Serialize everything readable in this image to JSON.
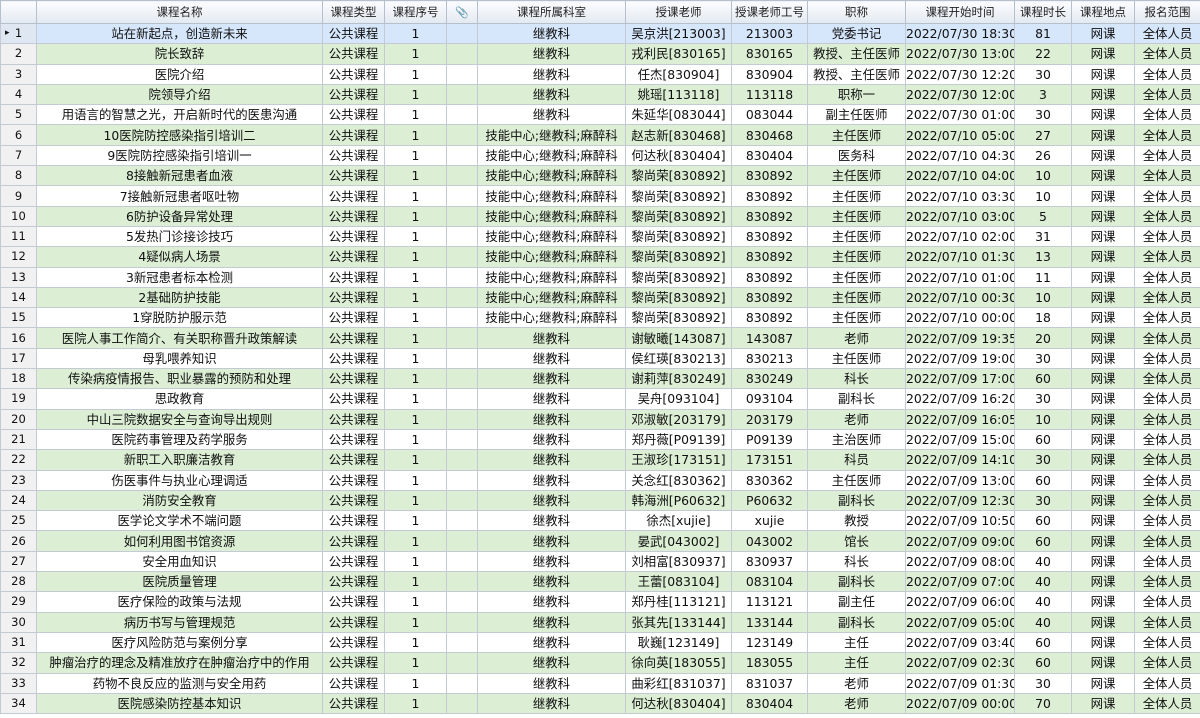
{
  "columns": [
    {
      "key": "rn",
      "label": ""
    },
    {
      "key": "name",
      "label": "课程名称"
    },
    {
      "key": "type",
      "label": "课程类型"
    },
    {
      "key": "seq",
      "label": "课程序号"
    },
    {
      "key": "attach",
      "label": "",
      "icon": "paperclip-icon"
    },
    {
      "key": "dept",
      "label": "课程所属科室"
    },
    {
      "key": "teacher",
      "label": "授课老师"
    },
    {
      "key": "tid",
      "label": "授课老师工号"
    },
    {
      "key": "title",
      "label": "职称"
    },
    {
      "key": "start",
      "label": "课程开始时间"
    },
    {
      "key": "duration",
      "label": "课程时长"
    },
    {
      "key": "place",
      "label": "课程地点"
    },
    {
      "key": "scope",
      "label": "报名范围"
    }
  ],
  "selected_row": 1,
  "rows": [
    {
      "rn": "1",
      "name": "站在新起点，创造新未来",
      "type": "公共课程",
      "seq": "1",
      "attach": "",
      "dept": "继教科",
      "teacher": "吴京洪[213003]",
      "tid": "213003",
      "title": "党委书记",
      "start": "2022/07/30 18:30",
      "duration": "81",
      "place": "网课",
      "scope": "全体人员"
    },
    {
      "rn": "2",
      "name": "院长致辞",
      "type": "公共课程",
      "seq": "1",
      "attach": "",
      "dept": "继教科",
      "teacher": "戎利民[830165]",
      "tid": "830165",
      "title": "教授、主任医师",
      "start": "2022/07/30 13:00",
      "duration": "22",
      "place": "网课",
      "scope": "全体人员"
    },
    {
      "rn": "3",
      "name": "医院介绍",
      "type": "公共课程",
      "seq": "1",
      "attach": "",
      "dept": "继教科",
      "teacher": "任杰[830904]",
      "tid": "830904",
      "title": "教授、主任医师",
      "start": "2022/07/30 12:20",
      "duration": "30",
      "place": "网课",
      "scope": "全体人员"
    },
    {
      "rn": "4",
      "name": "院领导介绍",
      "type": "公共课程",
      "seq": "1",
      "attach": "",
      "dept": "继教科",
      "teacher": "姚瑶[113118]",
      "tid": "113118",
      "title": "职称一",
      "start": "2022/07/30 12:00",
      "duration": "3",
      "place": "网课",
      "scope": "全体人员"
    },
    {
      "rn": "5",
      "name": "用语言的智慧之光，开启新时代的医患沟通",
      "type": "公共课程",
      "seq": "1",
      "attach": "",
      "dept": "继教科",
      "teacher": "朱延华[083044]",
      "tid": "083044",
      "title": "副主任医师",
      "start": "2022/07/30 01:00",
      "duration": "30",
      "place": "网课",
      "scope": "全体人员"
    },
    {
      "rn": "6",
      "name": "10医院防控感染指引培训二",
      "type": "公共课程",
      "seq": "1",
      "attach": "",
      "dept": "技能中心;继教科;麻醉科",
      "teacher": "赵志新[830468]",
      "tid": "830468",
      "title": "主任医师",
      "start": "2022/07/10 05:00",
      "duration": "27",
      "place": "网课",
      "scope": "全体人员"
    },
    {
      "rn": "7",
      "name": "9医院防控感染指引培训一",
      "type": "公共课程",
      "seq": "1",
      "attach": "",
      "dept": "技能中心;继教科;麻醉科",
      "teacher": "何达秋[830404]",
      "tid": "830404",
      "title": "医务科",
      "start": "2022/07/10 04:30",
      "duration": "26",
      "place": "网课",
      "scope": "全体人员"
    },
    {
      "rn": "8",
      "name": "8接触新冠患者血液",
      "type": "公共课程",
      "seq": "1",
      "attach": "",
      "dept": "技能中心;继教科;麻醉科",
      "teacher": "黎尚荣[830892]",
      "tid": "830892",
      "title": "主任医师",
      "start": "2022/07/10 04:00",
      "duration": "10",
      "place": "网课",
      "scope": "全体人员"
    },
    {
      "rn": "9",
      "name": "7接触新冠患者呕吐物",
      "type": "公共课程",
      "seq": "1",
      "attach": "",
      "dept": "技能中心;继教科;麻醉科",
      "teacher": "黎尚荣[830892]",
      "tid": "830892",
      "title": "主任医师",
      "start": "2022/07/10 03:30",
      "duration": "10",
      "place": "网课",
      "scope": "全体人员"
    },
    {
      "rn": "10",
      "name": "6防护设备异常处理",
      "type": "公共课程",
      "seq": "1",
      "attach": "",
      "dept": "技能中心;继教科;麻醉科",
      "teacher": "黎尚荣[830892]",
      "tid": "830892",
      "title": "主任医师",
      "start": "2022/07/10 03:00",
      "duration": "5",
      "place": "网课",
      "scope": "全体人员"
    },
    {
      "rn": "11",
      "name": "5发热门诊接诊技巧",
      "type": "公共课程",
      "seq": "1",
      "attach": "",
      "dept": "技能中心;继教科;麻醉科",
      "teacher": "黎尚荣[830892]",
      "tid": "830892",
      "title": "主任医师",
      "start": "2022/07/10 02:00",
      "duration": "31",
      "place": "网课",
      "scope": "全体人员"
    },
    {
      "rn": "12",
      "name": "4疑似病人场景",
      "type": "公共课程",
      "seq": "1",
      "attach": "",
      "dept": "技能中心;继教科;麻醉科",
      "teacher": "黎尚荣[830892]",
      "tid": "830892",
      "title": "主任医师",
      "start": "2022/07/10 01:30",
      "duration": "13",
      "place": "网课",
      "scope": "全体人员"
    },
    {
      "rn": "13",
      "name": "3新冠患者标本检测",
      "type": "公共课程",
      "seq": "1",
      "attach": "",
      "dept": "技能中心;继教科;麻醉科",
      "teacher": "黎尚荣[830892]",
      "tid": "830892",
      "title": "主任医师",
      "start": "2022/07/10 01:00",
      "duration": "11",
      "place": "网课",
      "scope": "全体人员"
    },
    {
      "rn": "14",
      "name": "2基础防护技能",
      "type": "公共课程",
      "seq": "1",
      "attach": "",
      "dept": "技能中心;继教科;麻醉科",
      "teacher": "黎尚荣[830892]",
      "tid": "830892",
      "title": "主任医师",
      "start": "2022/07/10 00:30",
      "duration": "10",
      "place": "网课",
      "scope": "全体人员"
    },
    {
      "rn": "15",
      "name": "1穿脱防护服示范",
      "type": "公共课程",
      "seq": "1",
      "attach": "",
      "dept": "技能中心;继教科;麻醉科",
      "teacher": "黎尚荣[830892]",
      "tid": "830892",
      "title": "主任医师",
      "start": "2022/07/10 00:00",
      "duration": "18",
      "place": "网课",
      "scope": "全体人员"
    },
    {
      "rn": "16",
      "name": "医院人事工作简介、有关职称晋升政策解读",
      "type": "公共课程",
      "seq": "1",
      "attach": "",
      "dept": "继教科",
      "teacher": "谢敏曦[143087]",
      "tid": "143087",
      "title": "老师",
      "start": "2022/07/09 19:35",
      "duration": "20",
      "place": "网课",
      "scope": "全体人员"
    },
    {
      "rn": "17",
      "name": "母乳喂养知识",
      "type": "公共课程",
      "seq": "1",
      "attach": "",
      "dept": "继教科",
      "teacher": "侯红瑛[830213]",
      "tid": "830213",
      "title": "主任医师",
      "start": "2022/07/09 19:00",
      "duration": "30",
      "place": "网课",
      "scope": "全体人员"
    },
    {
      "rn": "18",
      "name": "传染病疫情报告、职业暴露的预防和处理",
      "type": "公共课程",
      "seq": "1",
      "attach": "",
      "dept": "继教科",
      "teacher": "谢莉萍[830249]",
      "tid": "830249",
      "title": "科长",
      "start": "2022/07/09 17:00",
      "duration": "60",
      "place": "网课",
      "scope": "全体人员"
    },
    {
      "rn": "19",
      "name": "思政教育",
      "type": "公共课程",
      "seq": "1",
      "attach": "",
      "dept": "继教科",
      "teacher": "吴舟[093104]",
      "tid": "093104",
      "title": "副科长",
      "start": "2022/07/09 16:20",
      "duration": "30",
      "place": "网课",
      "scope": "全体人员"
    },
    {
      "rn": "20",
      "name": "中山三院数据安全与查询导出规则",
      "type": "公共课程",
      "seq": "1",
      "attach": "",
      "dept": "继教科",
      "teacher": "邓淑敏[203179]",
      "tid": "203179",
      "title": "老师",
      "start": "2022/07/09 16:05",
      "duration": "10",
      "place": "网课",
      "scope": "全体人员"
    },
    {
      "rn": "21",
      "name": "医院药事管理及药学服务",
      "type": "公共课程",
      "seq": "1",
      "attach": "",
      "dept": "继教科",
      "teacher": "郑丹薇[P09139]",
      "tid": "P09139",
      "title": "主治医师",
      "start": "2022/07/09 15:00",
      "duration": "60",
      "place": "网课",
      "scope": "全体人员"
    },
    {
      "rn": "22",
      "name": "新职工入职廉洁教育",
      "type": "公共课程",
      "seq": "1",
      "attach": "",
      "dept": "继教科",
      "teacher": "王淑珍[173151]",
      "tid": "173151",
      "title": "科员",
      "start": "2022/07/09 14:10",
      "duration": "30",
      "place": "网课",
      "scope": "全体人员"
    },
    {
      "rn": "23",
      "name": "伤医事件与执业心理调适",
      "type": "公共课程",
      "seq": "1",
      "attach": "",
      "dept": "继教科",
      "teacher": "关念红[830362]",
      "tid": "830362",
      "title": "主任医师",
      "start": "2022/07/09 13:00",
      "duration": "60",
      "place": "网课",
      "scope": "全体人员"
    },
    {
      "rn": "24",
      "name": "消防安全教育",
      "type": "公共课程",
      "seq": "1",
      "attach": "",
      "dept": "继教科",
      "teacher": "韩海洲[P60632]",
      "tid": "P60632",
      "title": "副科长",
      "start": "2022/07/09 12:30",
      "duration": "30",
      "place": "网课",
      "scope": "全体人员"
    },
    {
      "rn": "25",
      "name": "医学论文学术不端问题",
      "type": "公共课程",
      "seq": "1",
      "attach": "",
      "dept": "继教科",
      "teacher": "徐杰[xujie]",
      "tid": "xujie",
      "title": "教授",
      "start": "2022/07/09 10:50",
      "duration": "60",
      "place": "网课",
      "scope": "全体人员"
    },
    {
      "rn": "26",
      "name": "如何利用图书馆资源",
      "type": "公共课程",
      "seq": "1",
      "attach": "",
      "dept": "继教科",
      "teacher": "晏武[043002]",
      "tid": "043002",
      "title": "馆长",
      "start": "2022/07/09 09:00",
      "duration": "60",
      "place": "网课",
      "scope": "全体人员"
    },
    {
      "rn": "27",
      "name": "安全用血知识",
      "type": "公共课程",
      "seq": "1",
      "attach": "",
      "dept": "继教科",
      "teacher": "刘相富[830937]",
      "tid": "830937",
      "title": "科长",
      "start": "2022/07/09 08:00",
      "duration": "40",
      "place": "网课",
      "scope": "全体人员"
    },
    {
      "rn": "28",
      "name": "医院质量管理",
      "type": "公共课程",
      "seq": "1",
      "attach": "",
      "dept": "继教科",
      "teacher": "王蕾[083104]",
      "tid": "083104",
      "title": "副科长",
      "start": "2022/07/09 07:00",
      "duration": "40",
      "place": "网课",
      "scope": "全体人员"
    },
    {
      "rn": "29",
      "name": "医疗保险的政策与法规",
      "type": "公共课程",
      "seq": "1",
      "attach": "",
      "dept": "继教科",
      "teacher": "郑丹桂[113121]",
      "tid": "113121",
      "title": "副主任",
      "start": "2022/07/09 06:00",
      "duration": "40",
      "place": "网课",
      "scope": "全体人员"
    },
    {
      "rn": "30",
      "name": "病历书写与管理规范",
      "type": "公共课程",
      "seq": "1",
      "attach": "",
      "dept": "继教科",
      "teacher": "张其先[133144]",
      "tid": "133144",
      "title": "副科长",
      "start": "2022/07/09 05:00",
      "duration": "40",
      "place": "网课",
      "scope": "全体人员"
    },
    {
      "rn": "31",
      "name": "医疗风险防范与案例分享",
      "type": "公共课程",
      "seq": "1",
      "attach": "",
      "dept": "继教科",
      "teacher": "耿巍[123149]",
      "tid": "123149",
      "title": "主任",
      "start": "2022/07/09 03:40",
      "duration": "60",
      "place": "网课",
      "scope": "全体人员"
    },
    {
      "rn": "32",
      "name": "肿瘤治疗的理念及精准放疗在肿瘤治疗中的作用",
      "type": "公共课程",
      "seq": "1",
      "attach": "",
      "dept": "继教科",
      "teacher": "徐向英[183055]",
      "tid": "183055",
      "title": "主任",
      "start": "2022/07/09 02:30",
      "duration": "60",
      "place": "网课",
      "scope": "全体人员"
    },
    {
      "rn": "33",
      "name": "药物不良反应的监测与安全用药",
      "type": "公共课程",
      "seq": "1",
      "attach": "",
      "dept": "继教科",
      "teacher": "曲彩红[831037]",
      "tid": "831037",
      "title": "老师",
      "start": "2022/07/09 01:30",
      "duration": "30",
      "place": "网课",
      "scope": "全体人员"
    },
    {
      "rn": "34",
      "name": "医院感染防控基本知识",
      "type": "公共课程",
      "seq": "1",
      "attach": "",
      "dept": "继教科",
      "teacher": "何达秋[830404]",
      "tid": "830404",
      "title": "老师",
      "start": "2022/07/09 00:00",
      "duration": "70",
      "place": "网课",
      "scope": "全体人员"
    }
  ]
}
